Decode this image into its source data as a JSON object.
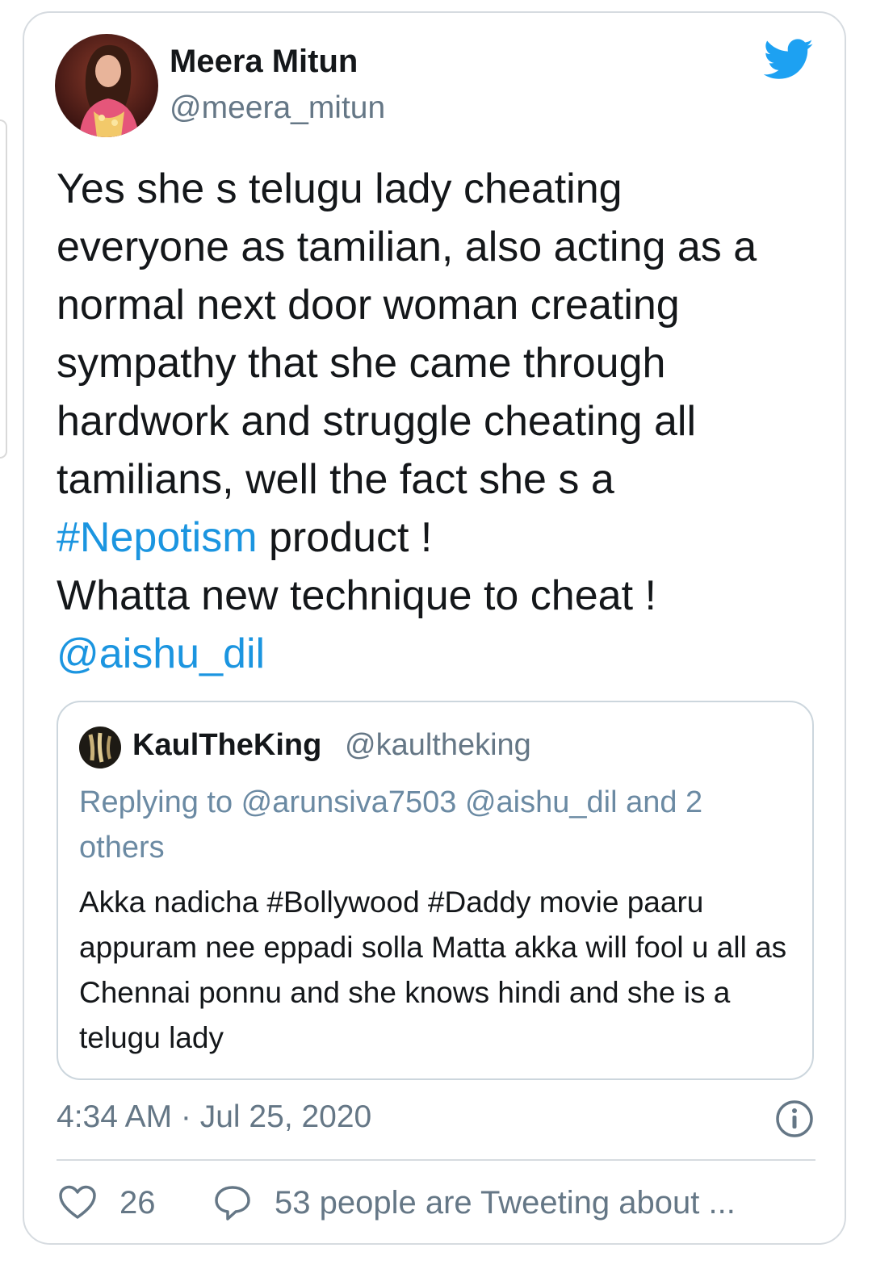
{
  "tweet": {
    "author_name": "Meera Mitun",
    "author_handle": "@meera_mitun",
    "text_lines": [
      "Yes she s telugu lady cheating",
      "everyone as tamilian, also acting as a",
      "normal next door woman creating",
      "sympathy that she came through",
      "hardwork and struggle cheating all",
      "tamilians, well the fact she s a"
    ],
    "hashtag": "#Nepotism",
    "after_hashtag": " product !",
    "line_last": "Whatta new technique to cheat !",
    "mention": "@aishu_dil",
    "timestamp": "4:34 AM · Jul 25, 2020",
    "likes": "26",
    "tweeting_about": "53 people are Tweeting about ..."
  },
  "quoted": {
    "name": "KaulTheKing",
    "handle": "@kaultheking",
    "replying_to": "Replying to @arunsiva7503 @aishu_dil and 2 others",
    "text": "Akka nadicha #Bollywood #Daddy movie paaru appuram nee eppadi solla Matta akka will fool u all as Chennai ponnu and she knows hindi and she is a telugu lady"
  },
  "icons": {
    "brand": "twitter-bird-icon",
    "info": "info-icon",
    "like": "heart-icon",
    "reply": "speech-bubble-icon"
  },
  "colors": {
    "link": "#1b95e0",
    "text": "#14171a",
    "secondary": "#657786",
    "border": "#d6dbe0"
  }
}
